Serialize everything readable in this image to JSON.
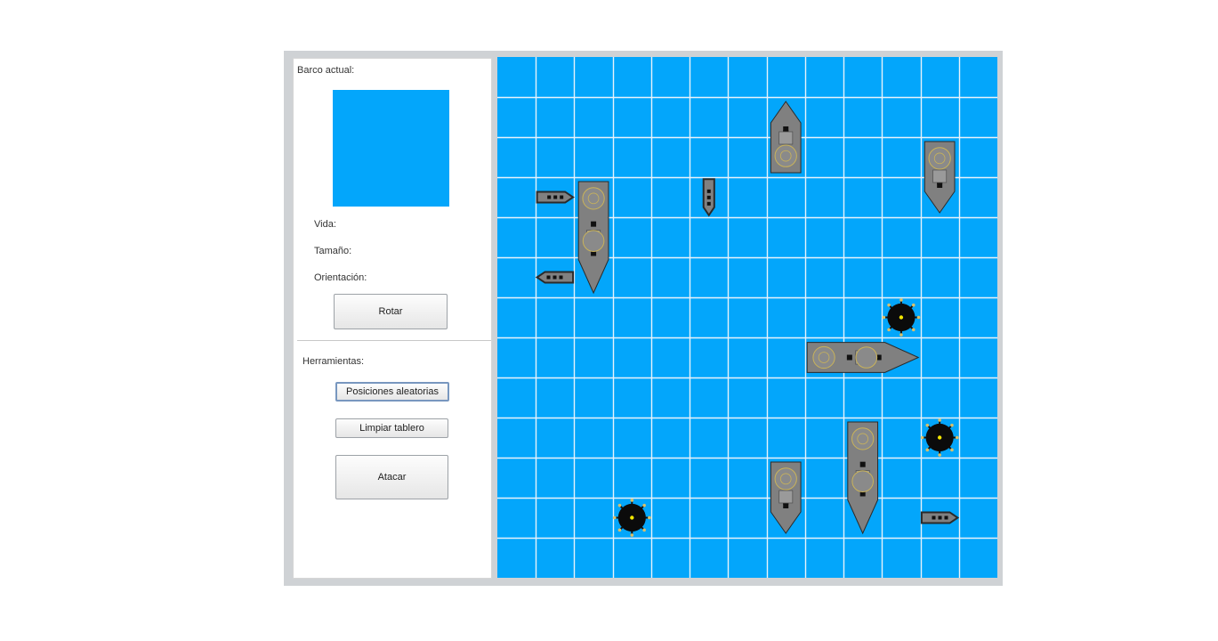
{
  "panel": {
    "current_ship_label": "Barco actual:",
    "life_label": "Vida:",
    "size_label": "Tamaño:",
    "orientation_label": "Orientación:",
    "rotate_button": "Rotar",
    "tools_label": "Herramientas:",
    "random_positions_button": "Posiciones aleatorias",
    "clear_board_button": "Limpiar tablero",
    "attack_button": "Atacar"
  },
  "board": {
    "columns": 13,
    "rows": 13,
    "water_color": "#03a6fb",
    "grid_color": "#e8f2fb",
    "ships": [
      {
        "kind": "battleship",
        "col": 2,
        "row": 3,
        "length": 3,
        "orientation": "vertical",
        "bow": "down"
      },
      {
        "kind": "cruiser",
        "col": 7,
        "row": 1,
        "length": 2,
        "orientation": "vertical",
        "bow": "up"
      },
      {
        "kind": "cruiser",
        "col": 11,
        "row": 2,
        "length": 2,
        "orientation": "vertical",
        "bow": "down"
      },
      {
        "kind": "battleship",
        "col": 8,
        "row": 7,
        "length": 3,
        "orientation": "horizontal",
        "bow": "right"
      },
      {
        "kind": "battleship",
        "col": 9,
        "row": 9,
        "length": 3,
        "orientation": "vertical",
        "bow": "down"
      },
      {
        "kind": "cruiser",
        "col": 7,
        "row": 10,
        "length": 2,
        "orientation": "vertical",
        "bow": "down"
      },
      {
        "kind": "patrol-boat",
        "col": 1,
        "row": 3,
        "orientation": "horizontal",
        "bow": "right"
      },
      {
        "kind": "patrol-boat",
        "col": 1,
        "row": 5,
        "orientation": "horizontal",
        "bow": "left"
      },
      {
        "kind": "patrol-boat",
        "col": 5,
        "row": 3,
        "orientation": "vertical",
        "bow": "down"
      },
      {
        "kind": "patrol-boat",
        "col": 11,
        "row": 11,
        "orientation": "horizontal",
        "bow": "right"
      }
    ],
    "mines": [
      {
        "col": 10,
        "row": 6
      },
      {
        "col": 11,
        "row": 9
      },
      {
        "col": 3,
        "row": 11
      }
    ]
  }
}
